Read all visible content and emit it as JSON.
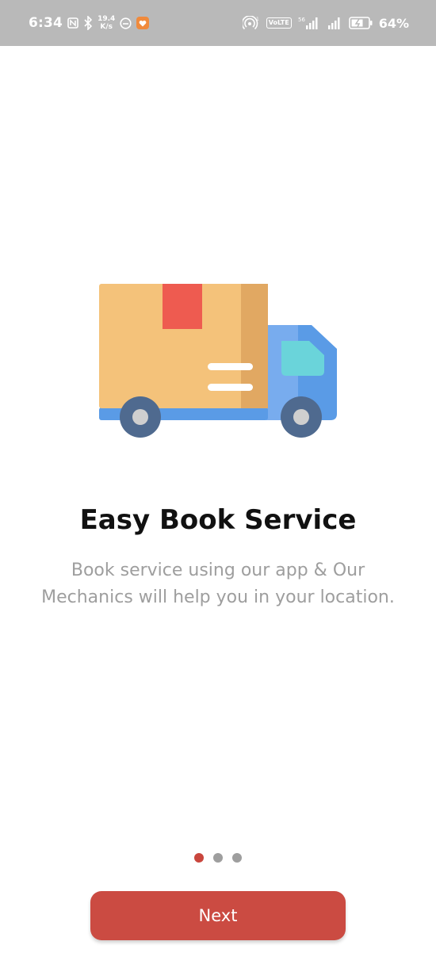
{
  "status_bar": {
    "time": "6:34",
    "net_speed_value": "19.4",
    "net_speed_unit": "K/s",
    "volte_label": "VoLTE",
    "battery_percent": "64%"
  },
  "onboarding": {
    "illustration": "delivery-truck-icon",
    "title": "Easy Book Service",
    "description": "Book service using our app & Our Mechanics will help you in your location.",
    "page_indicator": {
      "total": 3,
      "active_index": 0
    },
    "next_label": "Next"
  },
  "colors": {
    "primary": "#cb4b42",
    "active_dot": "#c9463d",
    "inactive_dot": "#9e9e9e",
    "status_bar_bg": "#b9b9b9",
    "description_text": "#9e9e9e"
  }
}
